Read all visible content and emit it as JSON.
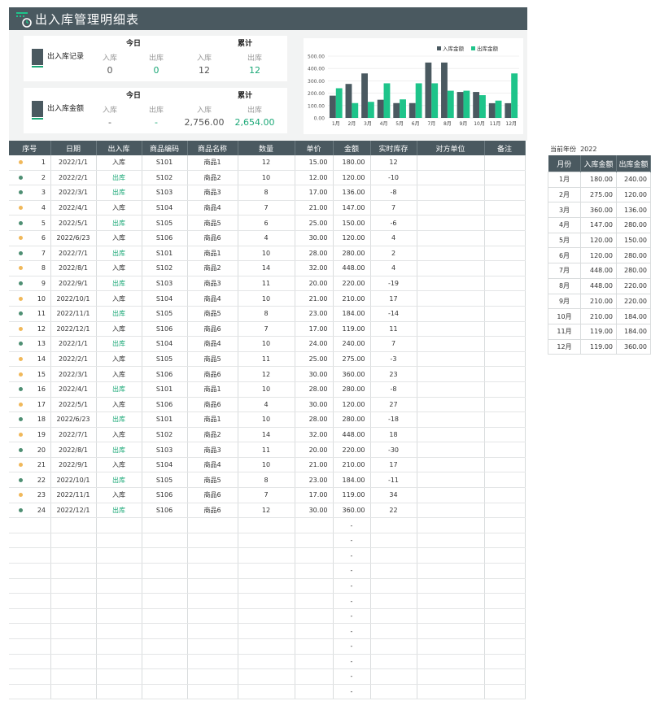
{
  "title": "出入库管理明细表",
  "kpi": [
    {
      "label": "出入库记录",
      "today": "今日",
      "total": "累计",
      "in": "入库",
      "out": "出库",
      "today_in": "0",
      "today_out": "0",
      "total_in": "12",
      "total_out": "12"
    },
    {
      "label": "出入库金额",
      "today": "今日",
      "total": "累计",
      "in": "入库",
      "out": "出库",
      "today_in": "-",
      "today_out": "-",
      "total_in": "2,756.00",
      "total_out": "2,654.00"
    }
  ],
  "chart_data": {
    "type": "bar",
    "categories": [
      "1月",
      "2月",
      "3月",
      "4月",
      "5月",
      "6月",
      "7月",
      "8月",
      "9月",
      "10月",
      "11月",
      "12月"
    ],
    "series": [
      {
        "name": "入库金额",
        "values": [
          180,
          275,
          360,
          147,
          120,
          120,
          448,
          448,
          210,
          210,
          119,
          119
        ],
        "color": "#4a5960"
      },
      {
        "name": "出库金额",
        "values": [
          240,
          120,
          130,
          280,
          150,
          280,
          280,
          220,
          220,
          184,
          140,
          360
        ],
        "color": "#1ec48a"
      }
    ],
    "ylim": [
      0,
      500
    ],
    "yticks": [
      "0.00",
      "100.00",
      "200.00",
      "300.00",
      "400.00",
      "500.00"
    ],
    "legend": "top-right"
  },
  "table": {
    "headers": [
      "序号",
      "日期",
      "出入库",
      "商品编码",
      "商品名称",
      "数量",
      "单价",
      "金额",
      "实时库存",
      "对方单位",
      "备注"
    ],
    "rows": [
      [
        "1",
        "2022/1/1",
        "入库",
        "S101",
        "商品1",
        "12",
        "15.00",
        "180.00",
        "12"
      ],
      [
        "2",
        "2022/2/1",
        "出库",
        "S102",
        "商品2",
        "10",
        "12.00",
        "120.00",
        "-10"
      ],
      [
        "3",
        "2022/3/1",
        "出库",
        "S103",
        "商品3",
        "8",
        "17.00",
        "136.00",
        "-8"
      ],
      [
        "4",
        "2022/4/1",
        "入库",
        "S104",
        "商品4",
        "7",
        "21.00",
        "147.00",
        "7"
      ],
      [
        "5",
        "2022/5/1",
        "出库",
        "S105",
        "商品5",
        "6",
        "25.00",
        "150.00",
        "-6"
      ],
      [
        "6",
        "2022/6/23",
        "入库",
        "S106",
        "商品6",
        "4",
        "30.00",
        "120.00",
        "4"
      ],
      [
        "7",
        "2022/7/1",
        "出库",
        "S101",
        "商品1",
        "10",
        "28.00",
        "280.00",
        "2"
      ],
      [
        "8",
        "2022/8/1",
        "入库",
        "S102",
        "商品2",
        "14",
        "32.00",
        "448.00",
        "4"
      ],
      [
        "9",
        "2022/9/1",
        "出库",
        "S103",
        "商品3",
        "11",
        "20.00",
        "220.00",
        "-19"
      ],
      [
        "10",
        "2022/10/1",
        "入库",
        "S104",
        "商品4",
        "10",
        "21.00",
        "210.00",
        "17"
      ],
      [
        "11",
        "2022/11/1",
        "出库",
        "S105",
        "商品5",
        "8",
        "23.00",
        "184.00",
        "-14"
      ],
      [
        "12",
        "2022/12/1",
        "入库",
        "S106",
        "商品6",
        "7",
        "17.00",
        "119.00",
        "11"
      ],
      [
        "13",
        "2022/1/1",
        "出库",
        "S104",
        "商品4",
        "10",
        "24.00",
        "240.00",
        "7"
      ],
      [
        "14",
        "2022/2/1",
        "入库",
        "S105",
        "商品5",
        "11",
        "25.00",
        "275.00",
        "-3"
      ],
      [
        "15",
        "2022/3/1",
        "入库",
        "S106",
        "商品6",
        "12",
        "30.00",
        "360.00",
        "23"
      ],
      [
        "16",
        "2022/4/1",
        "出库",
        "S101",
        "商品1",
        "10",
        "28.00",
        "280.00",
        "-8"
      ],
      [
        "17",
        "2022/5/1",
        "入库",
        "S106",
        "商品6",
        "4",
        "30.00",
        "120.00",
        "27"
      ],
      [
        "18",
        "2022/6/23",
        "出库",
        "S101",
        "商品1",
        "10",
        "28.00",
        "280.00",
        "-18"
      ],
      [
        "19",
        "2022/7/1",
        "入库",
        "S102",
        "商品2",
        "14",
        "32.00",
        "448.00",
        "18"
      ],
      [
        "20",
        "2022/8/1",
        "出库",
        "S103",
        "商品3",
        "11",
        "20.00",
        "220.00",
        "-30"
      ],
      [
        "21",
        "2022/9/1",
        "入库",
        "S104",
        "商品4",
        "10",
        "21.00",
        "210.00",
        "17"
      ],
      [
        "22",
        "2022/10/1",
        "出库",
        "S105",
        "商品5",
        "8",
        "23.00",
        "184.00",
        "-11"
      ],
      [
        "23",
        "2022/11/1",
        "入库",
        "S106",
        "商品6",
        "7",
        "17.00",
        "119.00",
        "34"
      ],
      [
        "24",
        "2022/12/1",
        "出库",
        "S106",
        "商品6",
        "12",
        "30.00",
        "360.00",
        "22"
      ]
    ],
    "empty_amount": "-"
  },
  "side": {
    "year_label": "当前年份",
    "year": "2022",
    "headers": [
      "月份",
      "入库金额",
      "出库金额"
    ],
    "rows": [
      [
        "1月",
        "180.00",
        "240.00"
      ],
      [
        "2月",
        "275.00",
        "120.00"
      ],
      [
        "3月",
        "360.00",
        "136.00"
      ],
      [
        "4月",
        "147.00",
        "280.00"
      ],
      [
        "5月",
        "120.00",
        "150.00"
      ],
      [
        "6月",
        "120.00",
        "280.00"
      ],
      [
        "7月",
        "448.00",
        "280.00"
      ],
      [
        "8月",
        "448.00",
        "220.00"
      ],
      [
        "9月",
        "210.00",
        "220.00"
      ],
      [
        "10月",
        "210.00",
        "184.00"
      ],
      [
        "11月",
        "119.00",
        "184.00"
      ],
      [
        "12月",
        "119.00",
        "360.00"
      ]
    ]
  },
  "colors": {
    "header": "#4a5960",
    "accent": "#1ba877",
    "in_dot": "#f0b85a",
    "out_dot": "#4e8f73"
  }
}
